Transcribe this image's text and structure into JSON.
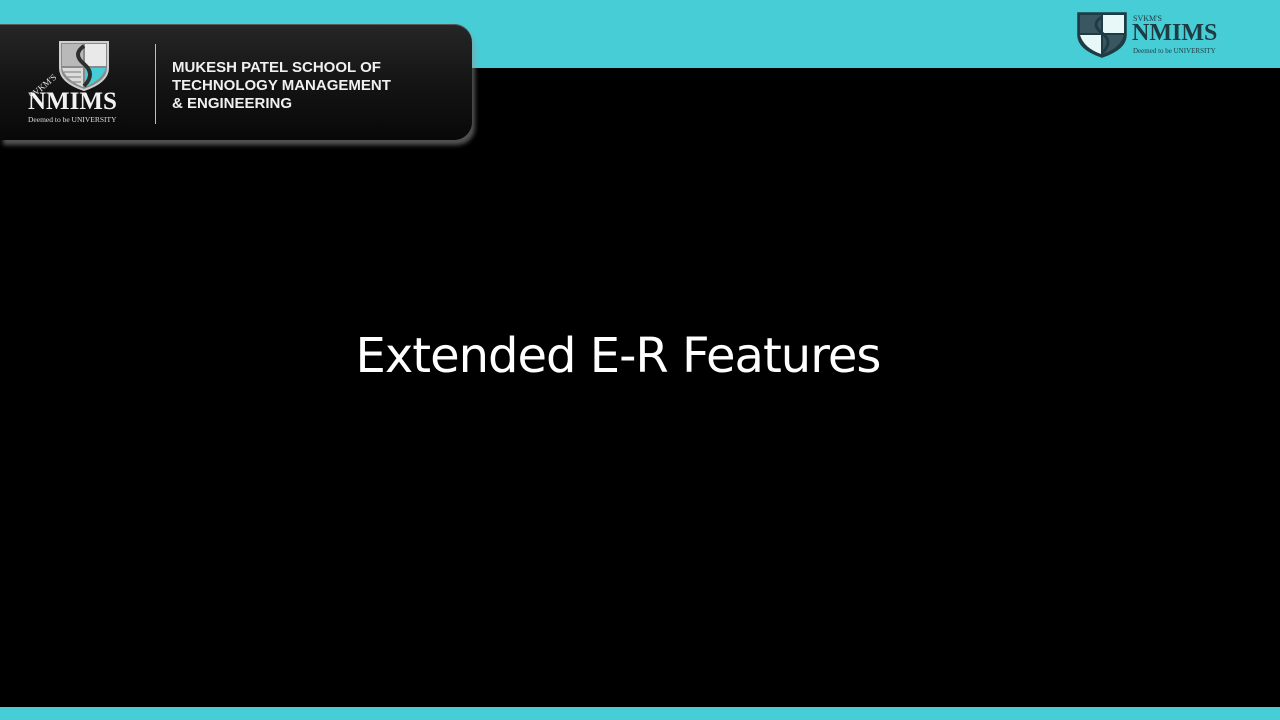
{
  "colors": {
    "accent_band": "#47CDD6",
    "background": "#000000",
    "title_text": "#ffffff"
  },
  "header": {
    "logo_left": {
      "svkm": "SVKM'S",
      "brand": "NMIMS",
      "deemed": "Deemed to be UNIVERSITY",
      "icon": "nmims-shield-icon"
    },
    "school_lines": [
      "MUKESH PATEL SCHOOL OF",
      "TECHNOLOGY MANAGEMENT",
      "& ENGINEERING"
    ]
  },
  "logo_right": {
    "svkm": "SVKM'S",
    "brand": "NMIMS",
    "deemed": "Deemed to be UNIVERSITY",
    "icon": "nmims-shield-icon"
  },
  "slide": {
    "title": "Extended E-R Features"
  }
}
